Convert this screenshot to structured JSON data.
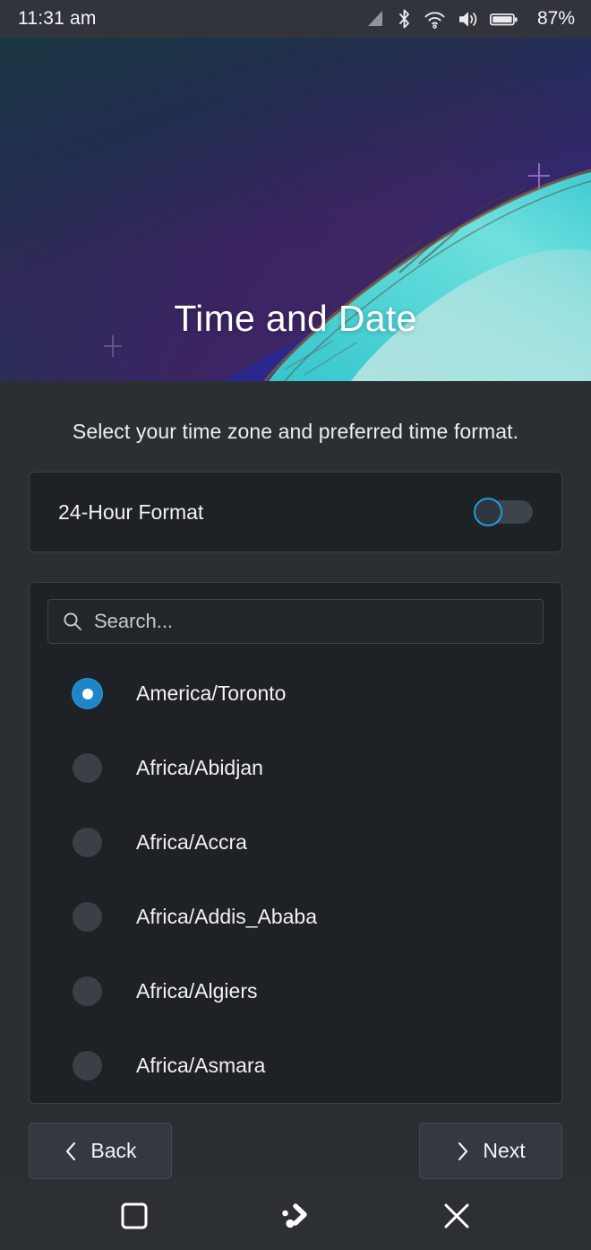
{
  "statusbar": {
    "clock": "11:31 am",
    "battery_percent": "87%",
    "icons": [
      "cellular-signal-icon",
      "bluetooth-icon",
      "wifi-icon",
      "volume-icon",
      "battery-icon"
    ]
  },
  "banner": {
    "title": "Time and Date"
  },
  "main": {
    "subtitle": "Select your time zone and preferred time format.",
    "time_format": {
      "label": "24-Hour Format",
      "enabled": false
    },
    "search": {
      "placeholder": "Search...",
      "value": ""
    },
    "timezones": [
      {
        "name": "America/Toronto",
        "selected": true
      },
      {
        "name": "Africa/Abidjan",
        "selected": false
      },
      {
        "name": "Africa/Accra",
        "selected": false
      },
      {
        "name": "Africa/Addis_Ababa",
        "selected": false
      },
      {
        "name": "Africa/Algiers",
        "selected": false
      },
      {
        "name": "Africa/Asmara",
        "selected": false
      }
    ],
    "back_label": "Back",
    "next_label": "Next"
  },
  "bottomnav": {
    "items": [
      "home-square-icon",
      "kde-plasma-task-switcher-icon",
      "close-x-icon"
    ]
  },
  "colors": {
    "accent_blue": "#1f9ede",
    "radio_selected": "#1f85c9",
    "page_background": "#2b2f34",
    "card_background": "#1e2125",
    "text_primary": "#f0f2f3"
  }
}
